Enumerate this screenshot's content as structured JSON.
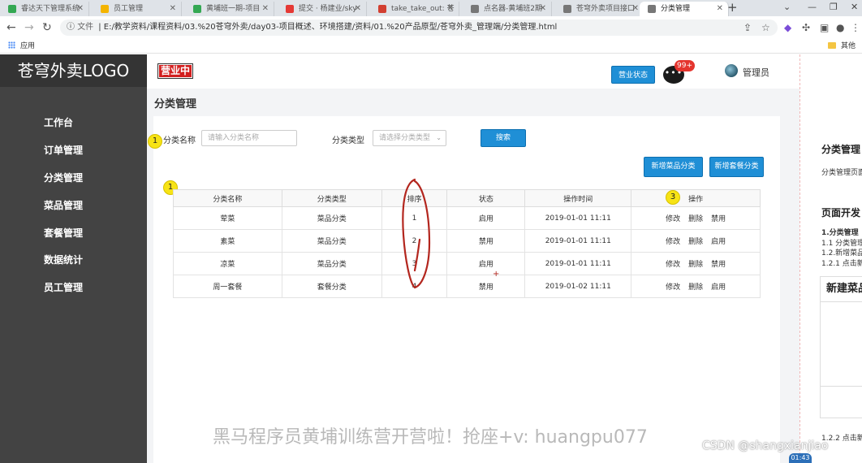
{
  "browser": {
    "tabs": [
      {
        "title": "睿达天下管理系统",
        "color": "#34a853",
        "active": false
      },
      {
        "title": "员工管理",
        "color": "#f4b400",
        "active": false
      },
      {
        "title": "黄埔班一期-项目",
        "color": "#34a853",
        "active": false
      },
      {
        "title": "提交 · 杨建业/sky",
        "color": "#e53935",
        "active": false
      },
      {
        "title": "take_take_out: 苍",
        "color": "#d23f31",
        "active": false
      },
      {
        "title": "点名器-黄埔班2期",
        "color": "#777777",
        "active": false
      },
      {
        "title": "苍穹外卖项目接口",
        "color": "#777777",
        "active": false
      },
      {
        "title": "分类管理",
        "color": "#777777",
        "active": true
      }
    ],
    "new_tab": "+",
    "address_prefix": "文件",
    "address": "E:/教学资料/课程资料/03.%20苍穹外卖/day03-项目概述、环境搭建/资料/01.%20产品原型/苍穹外卖_管理端/分类管理.html",
    "bookmarks": {
      "apps": "应用",
      "other": "其他书签"
    }
  },
  "sidebar": {
    "logo": "苍穹外卖LOGO",
    "items": [
      "工作台",
      "订单管理",
      "分类管理",
      "菜品管理",
      "套餐管理",
      "数据统计",
      "员工管理"
    ]
  },
  "header": {
    "business_badge": "营业中",
    "status_button": "营业状态",
    "message_icon": "chat-bubble-icon",
    "message_count": "99+",
    "admin": "管理员"
  },
  "page": {
    "title": "分类管理",
    "filters": {
      "name_label": "分类名称",
      "name_placeholder": "请输入分类名称",
      "type_label": "分类类型",
      "type_placeholder": "请选择分类类型",
      "search": "搜索"
    },
    "actions": {
      "add_dish": "新增菜品分类",
      "add_setmeal": "新增套餐分类"
    },
    "table": {
      "headers": [
        "分类名称",
        "分类类型",
        "排序",
        "状态",
        "操作时间",
        "操作"
      ],
      "rows": [
        {
          "name": "荤菜",
          "type": "菜品分类",
          "sort": "1",
          "status": "启用",
          "time": "2019-01-01 11:11",
          "ops": [
            "修改",
            "删除",
            "禁用"
          ]
        },
        {
          "name": "素菜",
          "type": "菜品分类",
          "sort": "2",
          "status": "禁用",
          "time": "2019-01-01 11:11",
          "ops": [
            "修改",
            "删除",
            "启用"
          ]
        },
        {
          "name": "凉菜",
          "type": "菜品分类",
          "sort": "3",
          "status": "启用",
          "time": "2019-01-01 11:11",
          "ops": [
            "修改",
            "删除",
            "禁用"
          ]
        },
        {
          "name": "周一套餐",
          "type": "套餐分类",
          "sort": "4",
          "status": "禁用",
          "time": "2019-01-02 11:11",
          "ops": [
            "修改",
            "删除",
            "启用"
          ]
        }
      ]
    },
    "markers": [
      "1",
      "1",
      "3"
    ]
  },
  "overlay": {
    "watermark": "黑马程序员黄埔训练营开营啦！抢座+v: huangpu077",
    "csdn": "CSDN @shangxianjiao",
    "time": "01:43",
    "annotation_color": "#b3261e"
  },
  "doc": {
    "h1": "分类管理",
    "t1": "分类管理页面",
    "h2": "页面开发",
    "t2": "1.分类管理",
    "t3": "1.1 分类管理",
    "t4": "1.2.新增菜品",
    "t5": "1.2.1 点击新",
    "box_title": "新建菜品",
    "t6": "1.2.2 点击新"
  }
}
